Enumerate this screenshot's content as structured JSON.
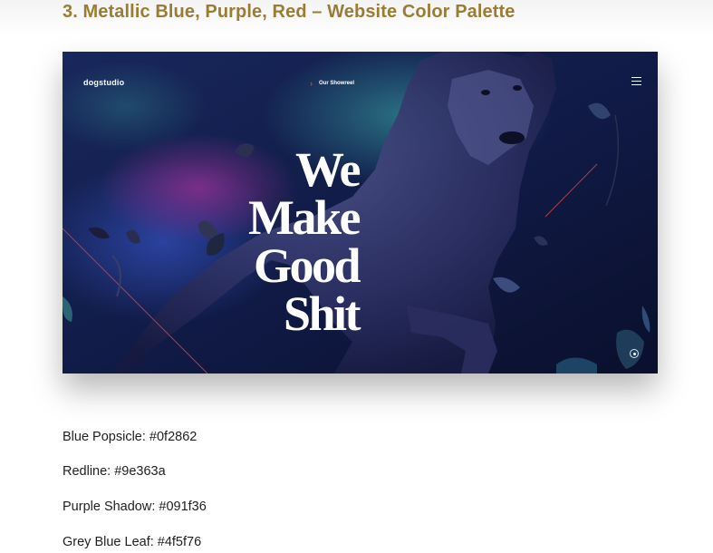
{
  "heading": "3. Metallic Blue, Purple, Red – Website Color Palette",
  "screenshot": {
    "logo": "dogstudio",
    "nav_chevron": "›",
    "showreel_label": "Our Showreel",
    "menu_icon": "hamburger-menu-icon",
    "hero_lines": [
      "We",
      "Make",
      "Good",
      "Shit"
    ],
    "scroll_icon": "scroll-indicator-icon"
  },
  "palette": [
    {
      "name": "Blue Popsicle",
      "hex": "#0f2862",
      "text": "Blue Popsicle: #0f2862"
    },
    {
      "name": "Redline",
      "hex": "#9e363a",
      "text": "Redline: #9e363a"
    },
    {
      "name": "Purple Shadow",
      "hex": "#091f36",
      "text": "Purple Shadow: #091f36"
    },
    {
      "name": "Grey Blue Leaf",
      "hex": "#4f5f76",
      "text": "Grey Blue Leaf: #4f5f76"
    }
  ],
  "colors": {
    "heading": "#9a7d34",
    "accent_red": "#e2394a",
    "bg_dark": "#0e1640"
  }
}
